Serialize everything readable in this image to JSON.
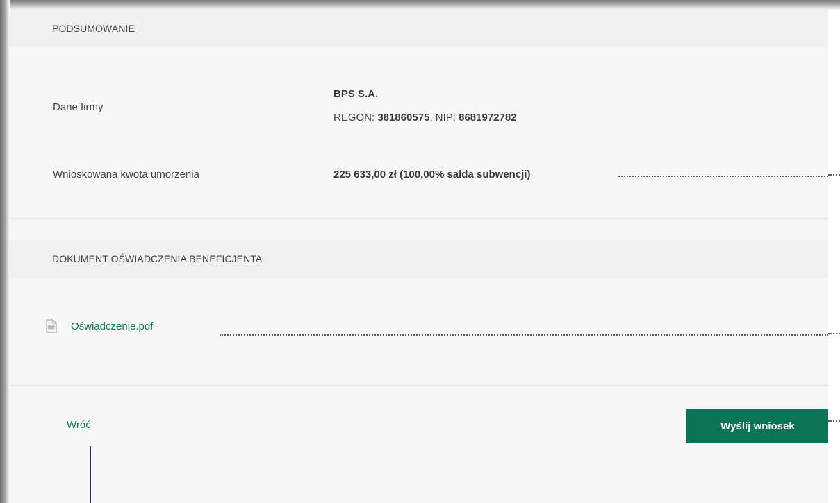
{
  "summary": {
    "header": "PODSUMOWANIE",
    "company_label": "Dane firmy",
    "company_name": "BPS S.A.",
    "regon_label": "REGON: ",
    "regon_value": "381860575",
    "nip_sep": ", NIP: ",
    "nip_value": "8681972782",
    "amount_label": "Wnioskowana kwota umorzenia",
    "amount_value": "225 633,00 zł (100,00% salda subwencji)"
  },
  "document": {
    "header": "DOKUMENT OŚWIADCZENIA BENEFICJENTA",
    "file_icon": "pdf-file-icon",
    "file_name": "Oświadczenie.pdf"
  },
  "actions": {
    "back_label": "Wróć",
    "submit_label": "Wyślij wniosek"
  },
  "colors": {
    "accent": "#0b7456",
    "link": "#0e7a5a",
    "pointer": "#2b2f55"
  }
}
